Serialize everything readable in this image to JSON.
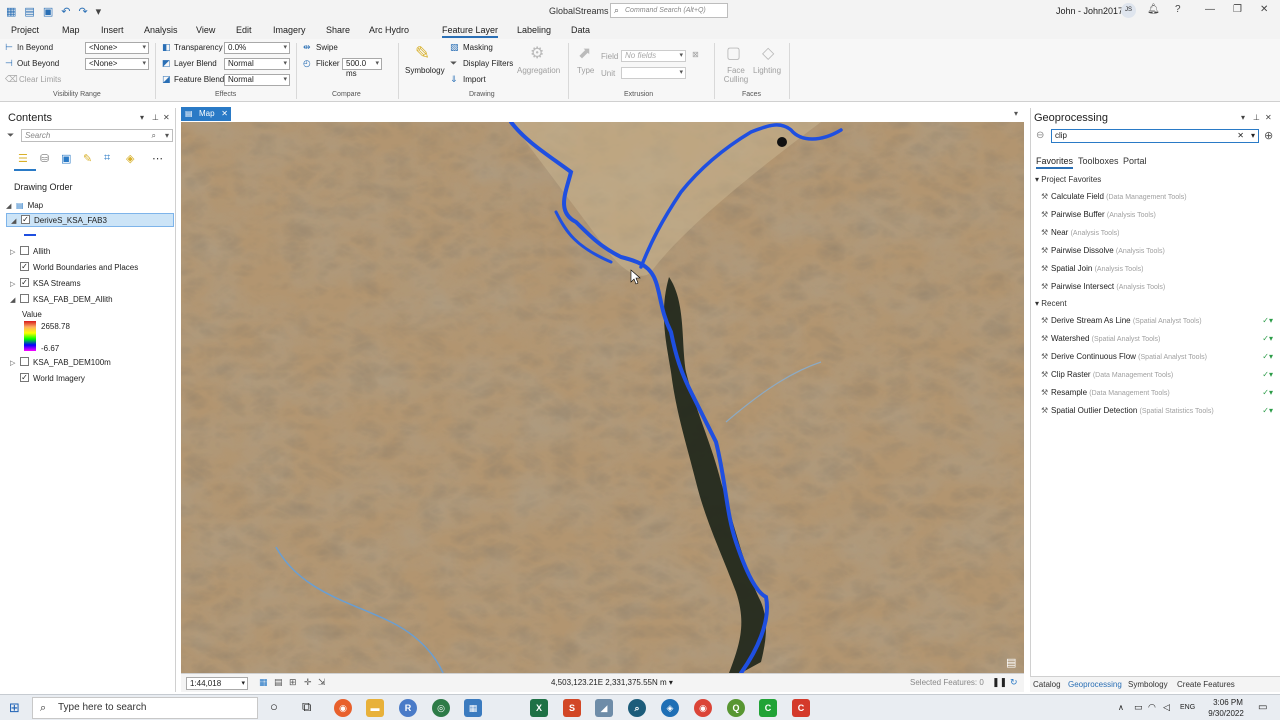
{
  "title_bar": {
    "app_title": "GlobalStreams",
    "command_search_placeholder": "Command Search (Alt+Q)",
    "user_name": "John - John2017",
    "user_initials": "JS"
  },
  "ribbon_tabs": [
    "Project",
    "Map",
    "Insert",
    "Analysis",
    "View",
    "Edit",
    "Imagery",
    "Share",
    "Arc Hydro",
    "Feature Layer",
    "Labeling",
    "Data"
  ],
  "active_tab": "Feature Layer",
  "ribbon": {
    "visibility_range": {
      "label": "Visibility Range",
      "in_beyond": "In Beyond",
      "out_beyond": "Out Beyond",
      "clear_limits": "Clear Limits",
      "in_value": "<None>",
      "out_value": "<None>"
    },
    "effects": {
      "label": "Effects",
      "transparency": "Transparency",
      "transparency_value": "0.0%",
      "layer_blend": "Layer Blend",
      "layer_blend_value": "Normal",
      "feature_blend": "Feature Blend",
      "feature_blend_value": "Normal"
    },
    "compare": {
      "label": "Compare",
      "swipe": "Swipe",
      "flicker": "Flicker",
      "flicker_value": "500.0",
      "flicker_unit": "ms"
    },
    "drawing": {
      "label": "Drawing",
      "symbology": "Symbology",
      "masking": "Masking",
      "display_filters": "Display Filters",
      "import": "Import",
      "aggregation": "Aggregation"
    },
    "extrusion": {
      "label": "Extrusion",
      "type": "Type",
      "field": "Field",
      "field_value": "No fields",
      "unit": "Unit"
    },
    "faces": {
      "label": "Faces",
      "face_culling": "Face Culling",
      "lighting": "Lighting"
    }
  },
  "contents": {
    "title": "Contents",
    "search_placeholder": "Search",
    "drawing_order": "Drawing Order",
    "layers": [
      {
        "name": "Map",
        "level": 0,
        "checkbox": false,
        "checked": false,
        "expander": "◢"
      },
      {
        "name": "DeriveS_KSA_FAB3",
        "level": 1,
        "checkbox": true,
        "checked": true,
        "expander": "◢",
        "selected": true
      },
      {
        "name": "Allith",
        "level": 1,
        "checkbox": true,
        "checked": false,
        "expander": "▷"
      },
      {
        "name": "World Boundaries and Places",
        "level": 1,
        "checkbox": true,
        "checked": true,
        "expander": ""
      },
      {
        "name": "KSA Streams",
        "level": 1,
        "checkbox": true,
        "checked": true,
        "expander": "▷"
      },
      {
        "name": "KSA_FAB_DEM_Allith",
        "level": 1,
        "checkbox": true,
        "checked": false,
        "expander": "◢"
      },
      {
        "name": "KSA_FAB_DEM100m",
        "level": 1,
        "checkbox": true,
        "checked": false,
        "expander": "▷"
      },
      {
        "name": "World Imagery",
        "level": 1,
        "checkbox": true,
        "checked": true,
        "expander": ""
      }
    ],
    "legend": {
      "title": "Value",
      "max": "2658.78",
      "min": "-6.67"
    }
  },
  "map": {
    "tab_label": "Map",
    "scale": "1:44,018",
    "coordinates": "4,503,123.21E 2,331,375.55N m",
    "selected_features": "Selected Features: 0",
    "stream_color": "#1f4fe0"
  },
  "geoprocessing": {
    "title": "Geoprocessing",
    "search_value": "clip",
    "tabs": [
      "Favorites",
      "Toolboxes",
      "Portal"
    ],
    "active_tab": "Favorites",
    "project_favorites_label": "Project Favorites",
    "favorites": [
      {
        "name": "Calculate Field",
        "toolbox": "(Data Management Tools)"
      },
      {
        "name": "Pairwise Buffer",
        "toolbox": "(Analysis Tools)"
      },
      {
        "name": "Near",
        "toolbox": "(Analysis Tools)"
      },
      {
        "name": "Pairwise Dissolve",
        "toolbox": "(Analysis Tools)"
      },
      {
        "name": "Spatial Join",
        "toolbox": "(Analysis Tools)"
      },
      {
        "name": "Pairwise Intersect",
        "toolbox": "(Analysis Tools)"
      }
    ],
    "recent_label": "Recent",
    "recent": [
      {
        "name": "Derive Stream As Line",
        "toolbox": "(Spatial Analyst Tools)"
      },
      {
        "name": "Watershed",
        "toolbox": "(Spatial Analyst Tools)"
      },
      {
        "name": "Derive Continuous Flow",
        "toolbox": "(Spatial Analyst Tools)"
      },
      {
        "name": "Clip Raster",
        "toolbox": "(Data Management Tools)"
      },
      {
        "name": "Resample",
        "toolbox": "(Data Management Tools)"
      },
      {
        "name": "Spatial Outlier Detection",
        "toolbox": "(Spatial Statistics Tools)"
      }
    ]
  },
  "bottom_tabs": [
    "Catalog",
    "Geoprocessing",
    "Symbology",
    "Create Features"
  ],
  "bottom_active": "Geoprocessing",
  "taskbar": {
    "search_placeholder": "Type here to search",
    "language": "ENG",
    "time": "3:06 PM",
    "date": "9/30/2022"
  }
}
